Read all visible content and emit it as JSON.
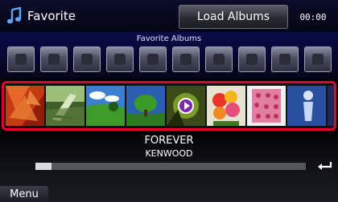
{
  "header": {
    "title": "Favorite",
    "title_icon": "music-note-icon",
    "load_button": "Load Albums",
    "clock": "00:00"
  },
  "favorites": {
    "label": "Favorite Albums",
    "slots": 10
  },
  "albums": [
    {
      "name": "red-flowers-cover"
    },
    {
      "name": "deck-chair-beach-cover"
    },
    {
      "name": "green-landscape-cover"
    },
    {
      "name": "tree-sky-cover"
    },
    {
      "name": "green-flower-cover",
      "playing": true
    },
    {
      "name": "flower-bouquet-cover"
    },
    {
      "name": "pink-pattern-cover"
    },
    {
      "name": "blue-figure-cover"
    }
  ],
  "now_playing": {
    "title": "FOREVER",
    "artist": "KENWOOD",
    "progress": 0.06
  },
  "footer": {
    "menu_label": "Menu",
    "return_icon": "return-icon"
  },
  "colors": {
    "selection_border": "#e6002d",
    "panel_blue": "#0a0c4a"
  }
}
